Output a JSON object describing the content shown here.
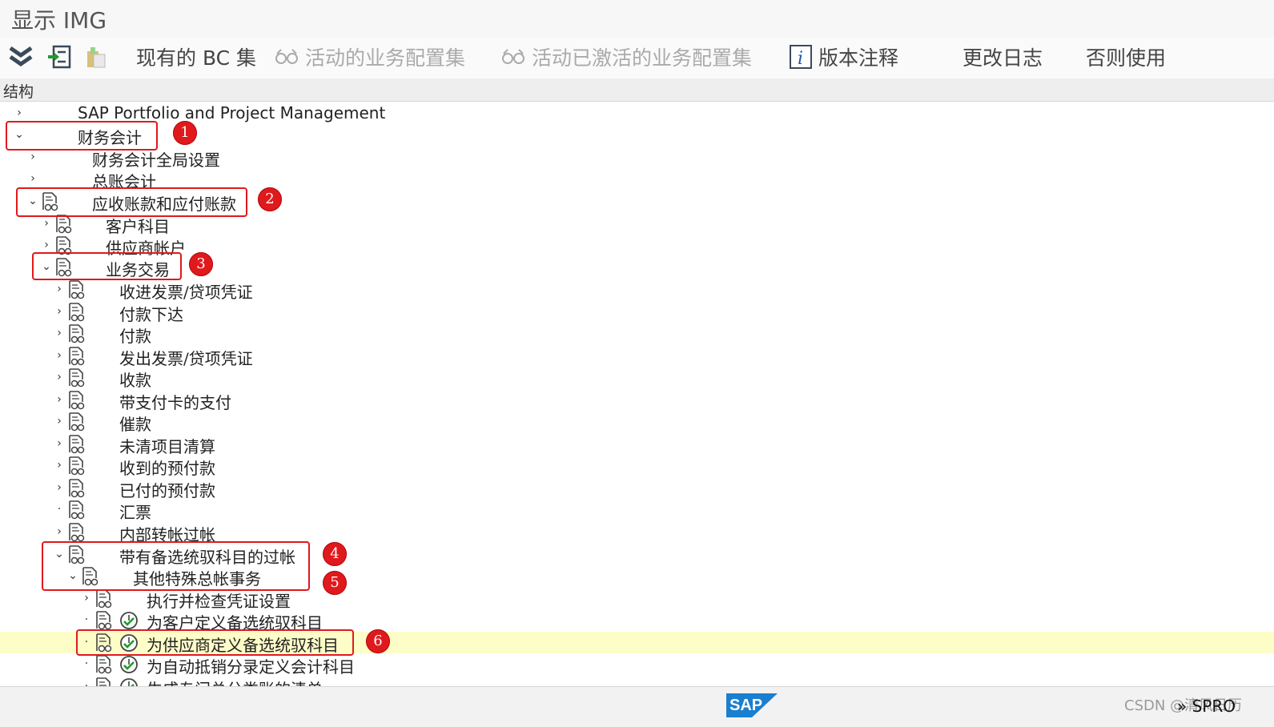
{
  "window": {
    "title": "显示 IMG"
  },
  "toolbar": {
    "existing_bc_label": "现有的 BC 集",
    "active_bc_label": "活动的业务配置集",
    "activated_bc_label": "活动已激活的业务配置集",
    "release_notes_label": "版本注释",
    "change_log_label": "更改日志",
    "where_used_label": "否则使用"
  },
  "structure": {
    "header": "结构"
  },
  "tree": {
    "n0": "SAP Portfolio and Project Management",
    "n1": "财务会计",
    "n2": "财务会计全局设置",
    "n3": "总账会计",
    "n4": "应收账款和应付账款",
    "n5": "客户科目",
    "n6": "供应商帐户",
    "n7": "业务交易",
    "n8": "收进发票/贷项凭证",
    "n9": "付款下达",
    "n10": "付款",
    "n11": "发出发票/贷项凭证",
    "n12": "收款",
    "n13": "带支付卡的支付",
    "n14": "催款",
    "n15": "未清项目清算",
    "n16": "收到的预付款",
    "n17": "已付的预付款",
    "n18": "汇票",
    "n19": "内部转帐过帐",
    "n20": "带有备选统驭科目的过帐",
    "n21": "其他特殊总帐事务",
    "n22": "执行并检查凭证设置",
    "n23": "为客户定义备选统驭科目",
    "n24": "为供应商定义备选统驭科目",
    "n25": "为自动抵销分录定义会计科目",
    "n26": "生成专门总分类账的清单"
  },
  "callouts": {
    "c1": "1",
    "c2": "2",
    "c3": "3",
    "c4": "4",
    "c5": "5",
    "c6": "6"
  },
  "status": {
    "sap_logo": "SAP",
    "transaction": "» SPRO",
    "watermark": "CSDN @清风日历"
  },
  "colors": {
    "callout": "#e0191c",
    "highlight": "#fdfdc8",
    "sap_blue": "#1a7fd0",
    "exec_green": "#1f9a2d"
  }
}
